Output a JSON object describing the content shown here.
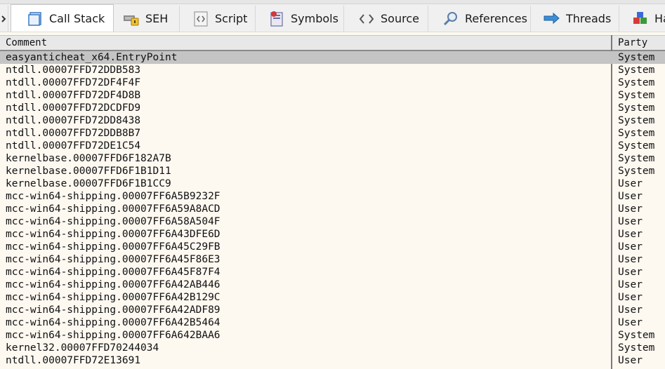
{
  "tabs": [
    {
      "label": "",
      "icon": "partial-tab-icon",
      "active": false
    },
    {
      "label": "Call Stack",
      "icon": "call-stack-icon",
      "active": true
    },
    {
      "label": "SEH",
      "icon": "seh-icon",
      "active": false
    },
    {
      "label": "Script",
      "icon": "script-icon",
      "active": false
    },
    {
      "label": "Symbols",
      "icon": "symbols-icon",
      "active": false
    },
    {
      "label": "Source",
      "icon": "source-icon",
      "active": false
    },
    {
      "label": "References",
      "icon": "references-icon",
      "active": false
    },
    {
      "label": "Threads",
      "icon": "threads-icon",
      "active": false
    },
    {
      "label": "Ha",
      "icon": "handles-icon",
      "active": false
    }
  ],
  "table": {
    "headers": {
      "comment": "Comment",
      "party": "Party"
    },
    "selected_row": 0,
    "rows": [
      {
        "comment": "easyanticheat_x64.EntryPoint",
        "party": "System"
      },
      {
        "comment": "ntdll.00007FFD72DDB583",
        "party": "System"
      },
      {
        "comment": "ntdll.00007FFD72DF4F4F",
        "party": "System"
      },
      {
        "comment": "ntdll.00007FFD72DF4D8B",
        "party": "System"
      },
      {
        "comment": "ntdll.00007FFD72DCDFD9",
        "party": "System"
      },
      {
        "comment": "ntdll.00007FFD72DD8438",
        "party": "System"
      },
      {
        "comment": "ntdll.00007FFD72DDB8B7",
        "party": "System"
      },
      {
        "comment": "ntdll.00007FFD72DE1C54",
        "party": "System"
      },
      {
        "comment": "kernelbase.00007FFD6F182A7B",
        "party": "System"
      },
      {
        "comment": "kernelbase.00007FFD6F1B1D11",
        "party": "System"
      },
      {
        "comment": "kernelbase.00007FFD6F1B1CC9",
        "party": "User"
      },
      {
        "comment": "mcc-win64-shipping.00007FF6A5B9232F",
        "party": "User"
      },
      {
        "comment": "mcc-win64-shipping.00007FF6A59A8ACD",
        "party": "User"
      },
      {
        "comment": "mcc-win64-shipping.00007FF6A58A504F",
        "party": "User"
      },
      {
        "comment": "mcc-win64-shipping.00007FF6A43DFE6D",
        "party": "User"
      },
      {
        "comment": "mcc-win64-shipping.00007FF6A45C29FB",
        "party": "User"
      },
      {
        "comment": "mcc-win64-shipping.00007FF6A45F86E3",
        "party": "User"
      },
      {
        "comment": "mcc-win64-shipping.00007FF6A45F87F4",
        "party": "User"
      },
      {
        "comment": "mcc-win64-shipping.00007FF6A42AB446",
        "party": "User"
      },
      {
        "comment": "mcc-win64-shipping.00007FF6A42B129C",
        "party": "User"
      },
      {
        "comment": "mcc-win64-shipping.00007FF6A42ADF89",
        "party": "User"
      },
      {
        "comment": "mcc-win64-shipping.00007FF6A42B5464",
        "party": "User"
      },
      {
        "comment": "mcc-win64-shipping.00007FF6A642BAA6",
        "party": "System"
      },
      {
        "comment": "kernel32.00007FFD70244034",
        "party": "System"
      },
      {
        "comment": "ntdll.00007FFD72E13691",
        "party": "User"
      }
    ]
  },
  "colors": {
    "background": "#fdf8f0",
    "selected_row": "#c4c4c4",
    "tabbar": "#f0f0f0"
  }
}
